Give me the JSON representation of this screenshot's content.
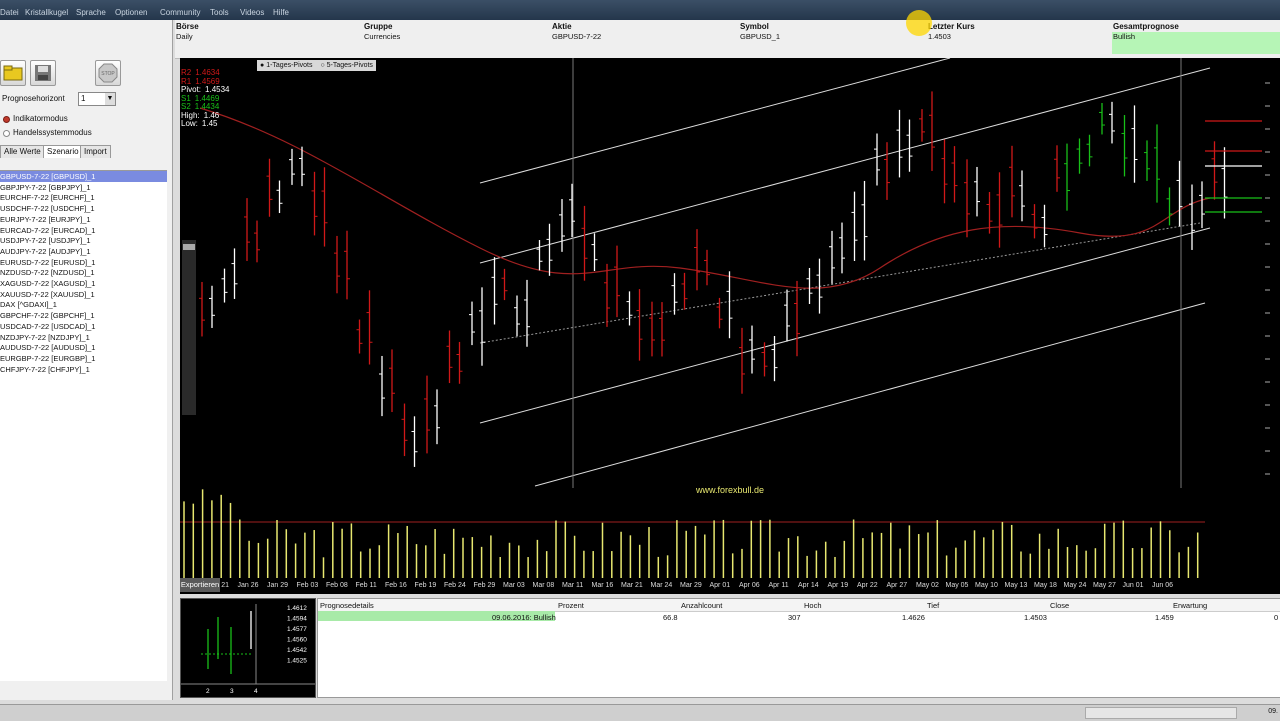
{
  "menu": [
    "Datei",
    "Kristallkugel",
    "Sprache",
    "Optionen",
    "Community",
    "Tools",
    "Videos",
    "Hilfe"
  ],
  "left": {
    "prognose_label": "Prognosehorizont",
    "prognose_value": "1",
    "mode_indicator": "Indikatormodus",
    "mode_trading": "Handelssystemmodus",
    "tabs": [
      "Alle Werte",
      "Szenario",
      "Import"
    ],
    "items": [
      "GBPUSD-7-22 [GBPUSD]_1",
      "GBPJPY-7-22 [GBPJPY]_1",
      "EURCHF-7-22 [EURCHF]_1",
      "USDCHF-7-22 [USDCHF]_1",
      "EURJPY-7-22 [EURJPY]_1",
      "EURCAD-7-22 [EURCAD]_1",
      "USDJPY-7-22 [USDJPY]_1",
      "AUDJPY-7-22 [AUDJPY]_1",
      "EURUSD-7-22 [EURUSD]_1",
      "NZDUSD-7-22 [NZDUSD]_1",
      "XAGUSD-7-22 [XAGUSD]_1",
      "XAUUSD-7-22 [XAUUSD]_1",
      "DAX [^GDAXI]_1",
      "GBPCHF-7-22 [GBPCHF]_1",
      "USDCAD-7-22 [USDCAD]_1",
      "NZDJPY-7-22 [NZDJPY]_1",
      "AUDUSD-7-22 [AUDUSD]_1",
      "EURGBP-7-22 [EURGBP]_1",
      "CHFJPY-7-22 [CHFJPY]_1"
    ]
  },
  "header": {
    "cols": [
      {
        "title": "Börse",
        "value": "Daily"
      },
      {
        "title": "Gruppe",
        "value": "Currencies"
      },
      {
        "title": "Aktie",
        "value": "GBPUSD-7-22"
      },
      {
        "title": "Symbol",
        "value": "GBPUSD_1"
      },
      {
        "title": "Letzter Kurs",
        "value": "1.4503"
      },
      {
        "title": "Gesamtprognose",
        "value": "Bullish"
      }
    ]
  },
  "chart": {
    "pivot_tabs": [
      "1-Tages-Pivots",
      "5-Tages-Pivots"
    ],
    "pivots": [
      {
        "label": "R2",
        "value": "1.4634",
        "color": "#d01818"
      },
      {
        "label": "R1",
        "value": "1.4569",
        "color": "#d01818"
      },
      {
        "label": "Pivot:",
        "value": "1.4534",
        "color": "#ffffff"
      },
      {
        "label": "S1",
        "value": "1.4469",
        "color": "#18c018"
      },
      {
        "label": "S2",
        "value": "1.4434",
        "color": "#18c018"
      },
      {
        "label": "High:",
        "value": "1.46",
        "color": "#ffffff"
      },
      {
        "label": "Low:",
        "value": "1.45",
        "color": "#ffffff"
      }
    ],
    "watermark": "www.forexbull.de",
    "x_labels": [
      "Jan 21",
      "Jan 26",
      "Jan 29",
      "Feb 03",
      "Feb 08",
      "Feb 11",
      "Feb 16",
      "Feb 19",
      "Feb 24",
      "Feb 29",
      "Mar 03",
      "Mar 08",
      "Mar 11",
      "Mar 16",
      "Mar 21",
      "Mar 24",
      "Mar 29",
      "Apr 01",
      "Apr 06",
      "Apr 11",
      "Apr 14",
      "Apr 19",
      "Apr 22",
      "Apr 27",
      "May 02",
      "May 05",
      "May 10",
      "May 13",
      "May 18",
      "May 24",
      "May 27",
      "Jun 01",
      "Jun 06"
    ],
    "export_label": "Exportieren",
    "colors": {
      "up": "#ffffff",
      "down": "#d01818",
      "bull": "#18c018",
      "volume": "#e8e870"
    }
  },
  "mini": {
    "prices": [
      "1.4612",
      "1.4594",
      "1.4577",
      "1.4560",
      "1.4542",
      "1.4525"
    ],
    "x": [
      "2",
      "3",
      "4"
    ]
  },
  "table": {
    "headers": [
      "Prognosedetails",
      "Prozent",
      "Anzahlcount",
      "Hoch",
      "Tief",
      "Close",
      "Erwartung"
    ],
    "row": [
      "09.06.2016: Bullish",
      "66.8",
      "307",
      "1.4626",
      "1.4503",
      "1.459",
      "0"
    ]
  },
  "status": "09."
}
